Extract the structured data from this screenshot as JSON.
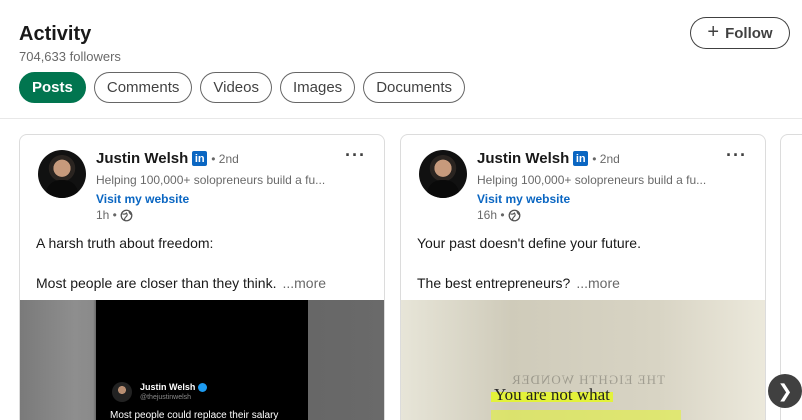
{
  "header": {
    "title": "Activity",
    "followers": "704,633 followers",
    "follow_label": "Follow"
  },
  "tabs": [
    {
      "label": "Posts",
      "active": true
    },
    {
      "label": "Comments",
      "active": false
    },
    {
      "label": "Videos",
      "active": false
    },
    {
      "label": "Images",
      "active": false
    },
    {
      "label": "Documents",
      "active": false
    }
  ],
  "posts": [
    {
      "author": "Justin Welsh",
      "badge": "in",
      "degree": "• 2nd",
      "headline": "Helping 100,000+ solopreneurs build a fu...",
      "website": "Visit my website",
      "time": "1h •",
      "line1": "A harsh truth about freedom:",
      "line2": "Most people are closer than they think.",
      "see_more": "...more",
      "media": {
        "name": "Justin Welsh",
        "handle": "@thejustinwelsh",
        "text": "Most people could replace their salary"
      }
    },
    {
      "author": "Justin Welsh",
      "badge": "in",
      "degree": "• 2nd",
      "headline": "Helping 100,000+ solopreneurs build a fu...",
      "website": "Visit my website",
      "time": "16h •",
      "line1": "Your past doesn't define your future.",
      "line2": "The best entrepreneurs?",
      "see_more": "...more",
      "media": {
        "faded_text": "THE EIGHTH WONDER",
        "highlight_text": "You are not what"
      }
    }
  ],
  "colors": {
    "active_tab": "#01754f",
    "link": "#0a66c2"
  },
  "icons": {
    "more": "ellipsis-icon",
    "globe": "globe-icon",
    "next": "chevron-right-icon"
  }
}
